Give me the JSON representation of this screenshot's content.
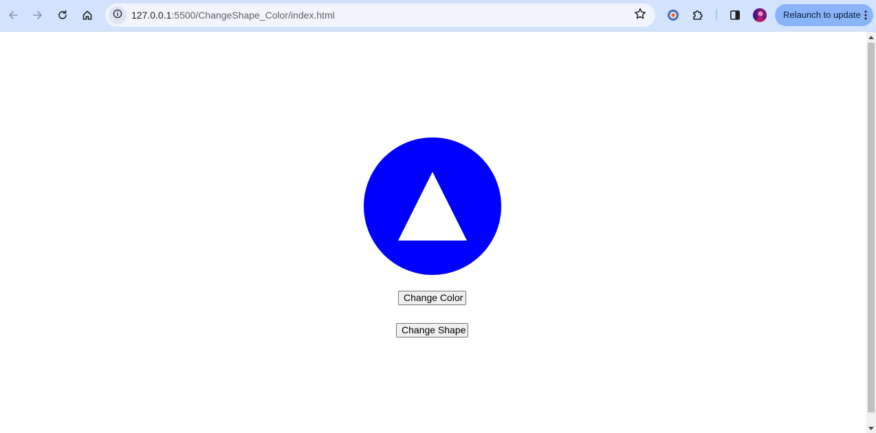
{
  "browser": {
    "url_host": "127.0.0.1",
    "url_path": ":5500/ChangeShape_Color/index.html",
    "relaunch_label": "Relaunch to update",
    "icons": {
      "back": "back-arrow-icon",
      "forward": "forward-arrow-icon",
      "reload": "reload-icon",
      "home": "home-icon",
      "site_info": "info-icon",
      "bookmark": "star-icon",
      "extension_1": "extension-logo-icon",
      "extensions": "puzzle-icon",
      "side_panel": "side-panel-icon",
      "profile": "avatar",
      "menu": "vertical-dots-icon"
    }
  },
  "page": {
    "shape": {
      "outer": "circle",
      "outer_color": "#0000ff",
      "inner": "triangle",
      "inner_color": "#ffffff"
    },
    "buttons": {
      "change_color": "Change Color",
      "change_shape": "Change Shape"
    }
  },
  "colors": {
    "toolbar_bg": "#d3e3fd",
    "relaunch_bg": "#8ab4f8",
    "shape_blue": "#0000ff"
  }
}
